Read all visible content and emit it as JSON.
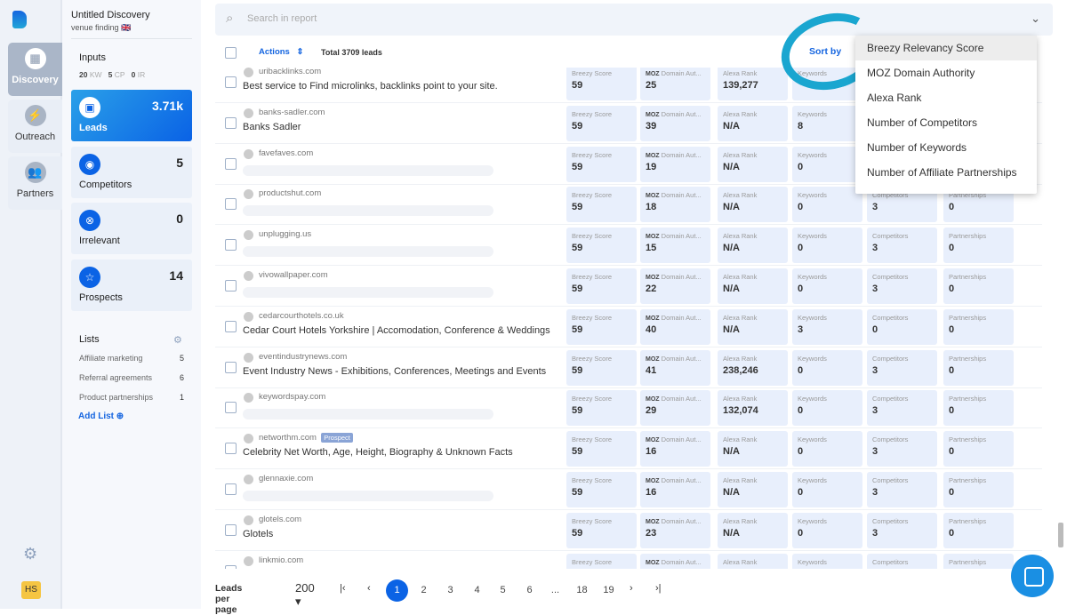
{
  "nav": [
    {
      "label": "Discovery",
      "icon": "grid-icon"
    },
    {
      "label": "Outreach",
      "icon": "bolt-icon"
    },
    {
      "label": "Partners",
      "icon": "people-icon"
    }
  ],
  "user": {
    "initials": "HS"
  },
  "panel": {
    "title": "Untitled Discovery",
    "subtitle": "venue finding 🇬🇧",
    "inputs_label": "Inputs",
    "inputs": [
      {
        "n": "20",
        "u": "KW"
      },
      {
        "n": "5",
        "u": "CP"
      },
      {
        "n": "0",
        "u": "IR"
      }
    ],
    "cards": [
      {
        "label": "Leads",
        "count": "3.71k",
        "icon": "inbox-icon"
      },
      {
        "label": "Competitors",
        "count": "5",
        "icon": "eye-icon"
      },
      {
        "label": "Irrelevant",
        "count": "0",
        "icon": "x-circle-icon"
      },
      {
        "label": "Prospects",
        "count": "14",
        "icon": "star-icon"
      }
    ],
    "lists_label": "Lists",
    "lists": [
      {
        "name": "Affiliate marketing",
        "count": "5"
      },
      {
        "name": "Referral agreements",
        "count": "6"
      },
      {
        "name": "Product partnerships",
        "count": "1"
      }
    ],
    "add_list": "Add List"
  },
  "search": {
    "placeholder": "Search in report"
  },
  "toolbar": {
    "actions": "Actions",
    "total": "Total 3709 leads",
    "sort_by": "Sort by"
  },
  "sort_options": [
    "Breezy Relevancy Score",
    "MOZ Domain Authority",
    "Alexa Rank",
    "Number of Competitors",
    "Number of Keywords",
    "Number of Affiliate Partnerships"
  ],
  "metric_labels": [
    "Breezy Score",
    "Domain Aut...",
    "Alexa Rank",
    "Keywords",
    "Competitors",
    "Partnerships"
  ],
  "moz_label": "MOZ",
  "rows": [
    {
      "domain": "uribacklinks.com",
      "title": "Best service to Find microlinks, backlinks point to your site.",
      "m": [
        "59",
        "25",
        "139,277",
        "",
        "",
        ""
      ]
    },
    {
      "domain": "banks-sadler.com",
      "title": "Banks Sadler",
      "m": [
        "59",
        "39",
        "N/A",
        "8",
        "",
        ""
      ]
    },
    {
      "domain": "favefaves.com",
      "title": "",
      "m": [
        "59",
        "19",
        "N/A",
        "0",
        "",
        ""
      ]
    },
    {
      "domain": "productshut.com",
      "title": "",
      "m": [
        "59",
        "18",
        "N/A",
        "0",
        "3",
        "0"
      ]
    },
    {
      "domain": "unplugging.us",
      "title": "",
      "m": [
        "59",
        "15",
        "N/A",
        "0",
        "3",
        "0"
      ]
    },
    {
      "domain": "vivowallpaper.com",
      "title": "",
      "m": [
        "59",
        "22",
        "N/A",
        "0",
        "3",
        "0"
      ]
    },
    {
      "domain": "cedarcourthotels.co.uk",
      "title": "Cedar Court Hotels Yorkshire | Accomodation, Conference & Weddings",
      "m": [
        "59",
        "40",
        "N/A",
        "3",
        "0",
        "0"
      ]
    },
    {
      "domain": "eventindustrynews.com",
      "title": "Event Industry News - Exhibitions, Conferences, Meetings and Events",
      "m": [
        "59",
        "41",
        "238,246",
        "0",
        "3",
        "0"
      ]
    },
    {
      "domain": "keywordspay.com",
      "title": "",
      "m": [
        "59",
        "29",
        "132,074",
        "0",
        "3",
        "0"
      ]
    },
    {
      "domain": "networthm.com",
      "badge": "Prospect",
      "title": "Celebrity Net Worth, Age, Height, Biography & Unknown Facts",
      "m": [
        "59",
        "16",
        "N/A",
        "0",
        "3",
        "0"
      ]
    },
    {
      "domain": "glennaxie.com",
      "title": "",
      "m": [
        "59",
        "16",
        "N/A",
        "0",
        "3",
        "0"
      ]
    },
    {
      "domain": "glotels.com",
      "title": "Glotels",
      "m": [
        "59",
        "23",
        "N/A",
        "0",
        "3",
        "0"
      ]
    },
    {
      "domain": "linkmio.com",
      "title": "",
      "m": [
        "",
        "",
        "",
        "",
        "",
        ""
      ]
    }
  ],
  "pager": {
    "label": "Leads per page",
    "per_page": "200",
    "pages": [
      "1",
      "2",
      "3",
      "4",
      "5",
      "6",
      "...",
      "18",
      "19"
    ],
    "current": "1"
  }
}
